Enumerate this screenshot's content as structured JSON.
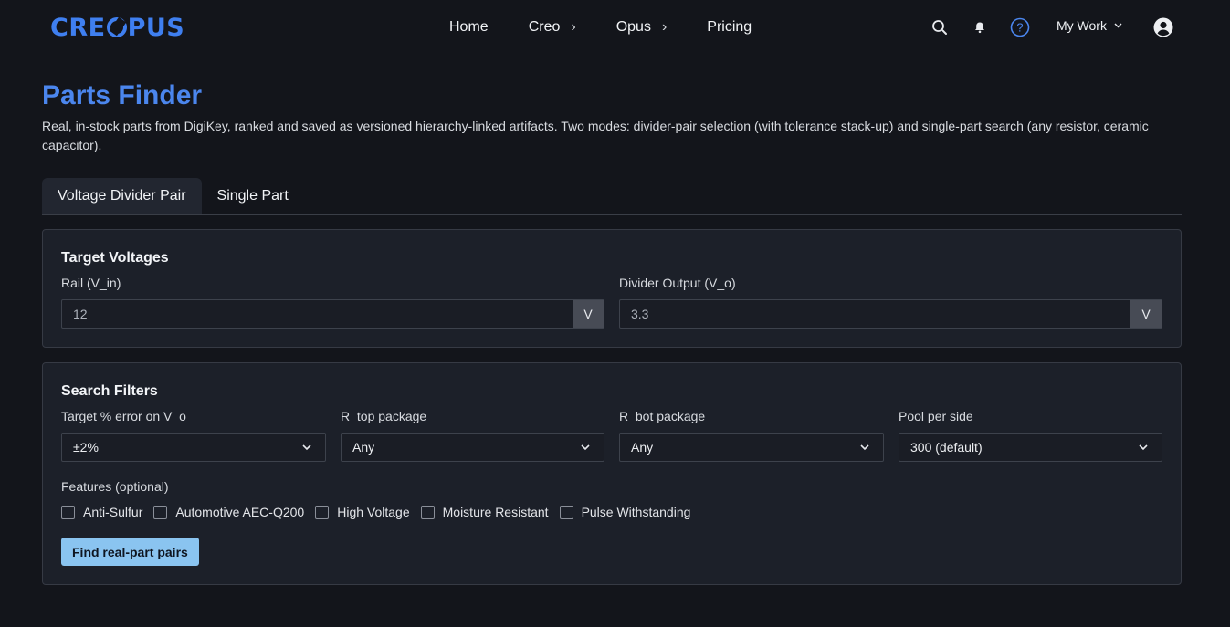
{
  "brand": {
    "logo_text_left": "CRE",
    "logo_text_right": "PUS",
    "accent_color": "#3f7ff0"
  },
  "nav": {
    "links": [
      {
        "label": "Home",
        "has_chevron": false
      },
      {
        "label": "Creo",
        "has_chevron": true
      },
      {
        "label": "Opus",
        "has_chevron": true
      },
      {
        "label": "Pricing",
        "has_chevron": false
      }
    ],
    "icons": [
      "search-icon",
      "bell-icon",
      "help-icon",
      "account-icon"
    ],
    "my_work_label": "My Work"
  },
  "page": {
    "title": "Parts Finder",
    "description": "Real, in-stock parts from DigiKey, ranked and saved as versioned hierarchy-linked artifacts. Two modes: divider-pair selection (with tolerance stack-up) and single-part search (any resistor, ceramic capacitor)."
  },
  "tabs": [
    {
      "label": "Voltage Divider Pair",
      "active": true
    },
    {
      "label": "Single Part",
      "active": false
    }
  ],
  "target_voltages": {
    "title": "Target Voltages",
    "rail": {
      "label": "Rail (V_in)",
      "value": "12",
      "unit": "V"
    },
    "output": {
      "label": "Divider Output (V_o)",
      "value": "3.3",
      "unit": "V"
    }
  },
  "filters": {
    "title": "Search Filters",
    "error": {
      "label": "Target % error on V_o",
      "value": "±2%"
    },
    "r_top": {
      "label": "R_top package",
      "value": "Any"
    },
    "r_bot": {
      "label": "R_bot package",
      "value": "Any"
    },
    "pool": {
      "label": "Pool per side",
      "value": "300 (default)"
    },
    "features_label": "Features (optional)",
    "features": [
      {
        "label": "Anti-Sulfur",
        "checked": false
      },
      {
        "label": "Automotive AEC-Q200",
        "checked": false
      },
      {
        "label": "High Voltage",
        "checked": false
      },
      {
        "label": "Moisture Resistant",
        "checked": false
      },
      {
        "label": "Pulse Withstanding",
        "checked": false
      }
    ],
    "submit_label": "Find real-part pairs"
  }
}
